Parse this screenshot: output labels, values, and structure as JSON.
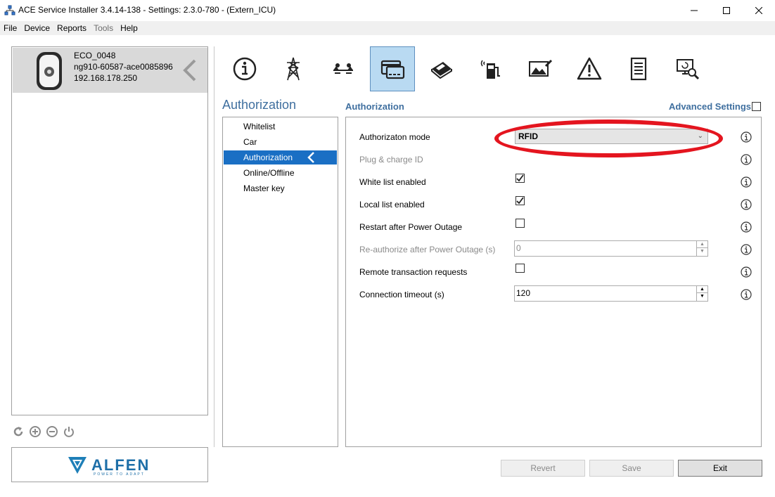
{
  "window": {
    "title": "ACE Service Installer 3.4.14-138 - Settings: 2.3.0-780 -  (Extern_ICU)"
  },
  "menu": [
    "File",
    "Device",
    "Reports",
    "Tools",
    "Help"
  ],
  "device": {
    "name": "ECO_0048",
    "id": "ng910-60587-ace0085896",
    "ip": "192.168.178.250"
  },
  "logo": {
    "brand": "ALFEN",
    "tagline": "POWER TO ADAPT"
  },
  "tabs": [
    "info",
    "grid",
    "balance",
    "authorization",
    "payment",
    "charging",
    "display",
    "warnings",
    "log",
    "diagnostics"
  ],
  "section_title": "Authorization",
  "submenu": [
    "Whitelist",
    "Car",
    "Authorization",
    "Online/Offline",
    "Master key"
  ],
  "panel": {
    "title": "Authorization",
    "advanced_label": "Advanced Settings",
    "rows": {
      "auth_mode": {
        "label": "Authorizaton mode",
        "value": "RFID"
      },
      "plug_charge": {
        "label": "Plug & charge ID"
      },
      "white_list": {
        "label": "White list enabled",
        "checked": true
      },
      "local_list": {
        "label": "Local list enabled",
        "checked": true
      },
      "restart": {
        "label": "Restart after Power Outage",
        "checked": false
      },
      "reauth": {
        "label": "Re-authorize after Power Outage (s)",
        "value": "0"
      },
      "remote": {
        "label": "Remote transaction requests",
        "checked": false
      },
      "timeout": {
        "label": "Connection timeout (s)",
        "value": "120"
      }
    }
  },
  "buttons": {
    "revert": "Revert",
    "save": "Save",
    "exit": "Exit"
  },
  "colors": {
    "accent": "#3f6f9f",
    "selection": "#1a6fc4",
    "active_tab": "#b9daf2",
    "highlight": "#e4151f"
  }
}
